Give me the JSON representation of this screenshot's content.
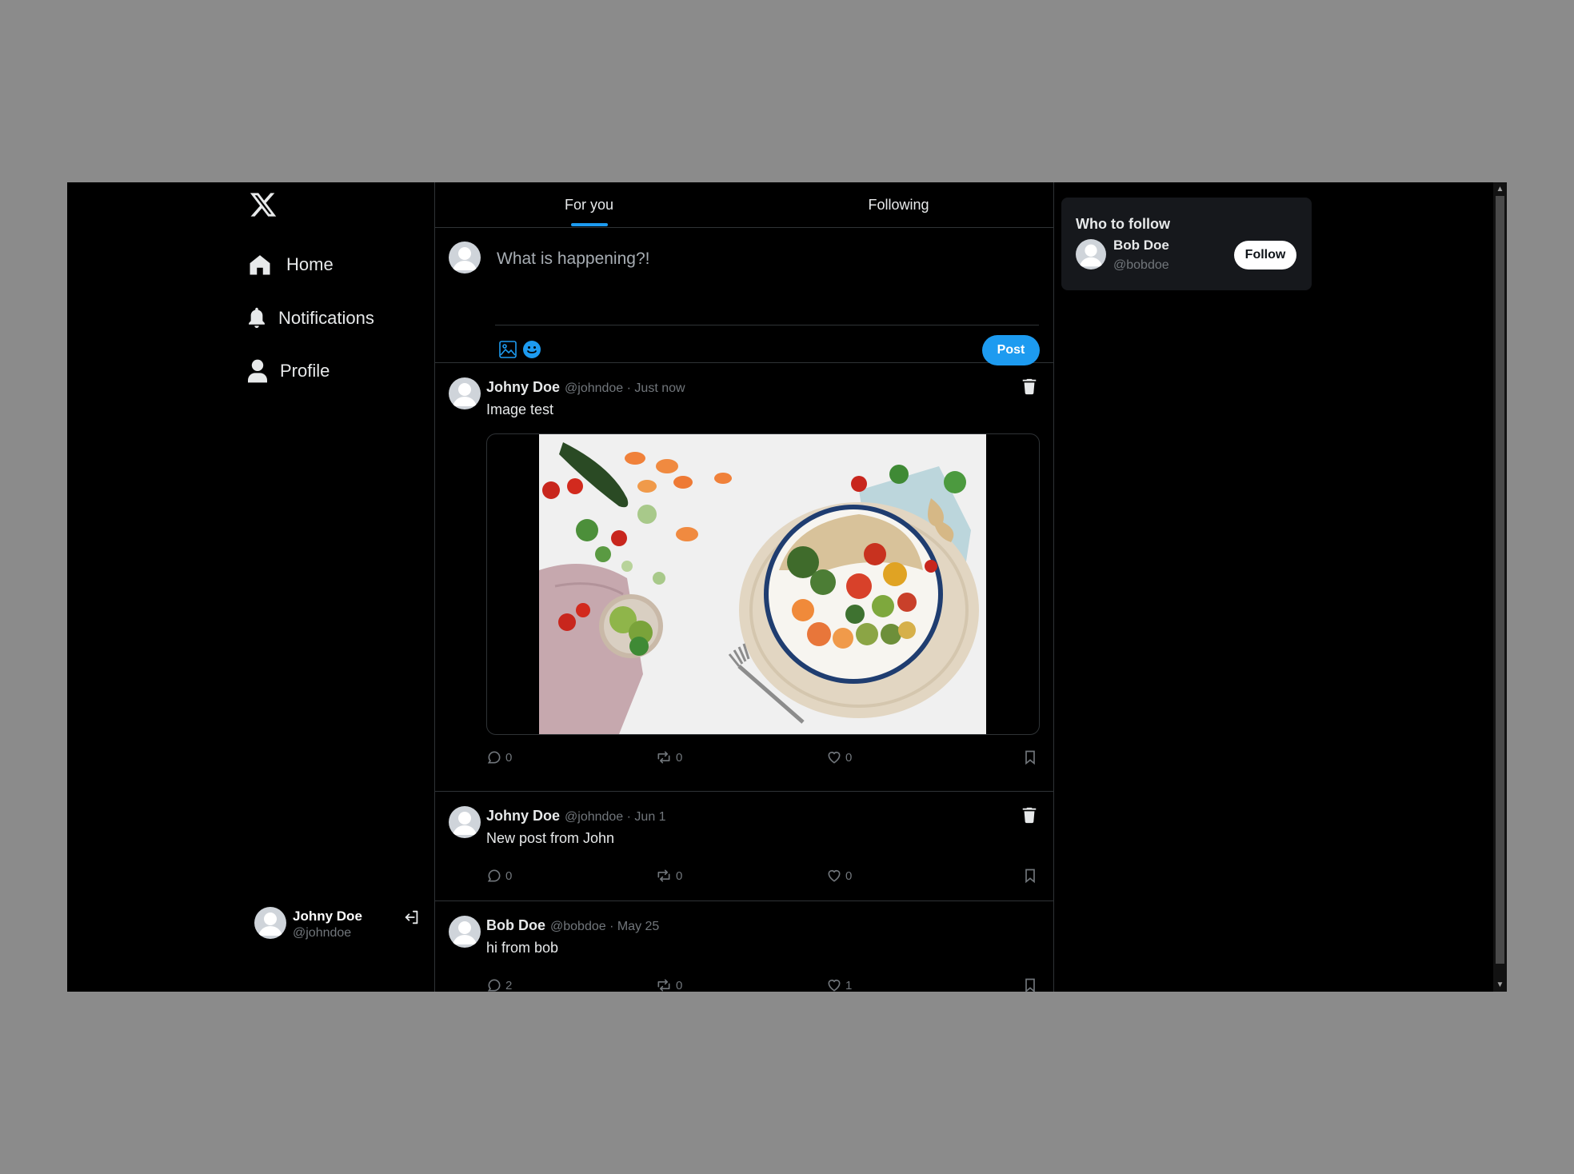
{
  "nav": {
    "logo": "x-logo",
    "items": [
      {
        "label": "Home",
        "icon": "home-icon"
      },
      {
        "label": "Notifications",
        "icon": "bell-icon"
      },
      {
        "label": "Profile",
        "icon": "user-icon"
      }
    ]
  },
  "account": {
    "name": "Johny Doe",
    "handle": "@johndoe"
  },
  "tabs": [
    {
      "label": "For you",
      "active": true
    },
    {
      "label": "Following",
      "active": false
    }
  ],
  "composer": {
    "placeholder": "What is happening?!",
    "post_label": "Post"
  },
  "posts": [
    {
      "name": "Johny Doe",
      "handle": "@johndoe",
      "time": "Just now",
      "meta": "@johndoe · Just now",
      "text": "Image test",
      "has_image": true,
      "deletable": true,
      "replies": "0",
      "reposts": "0",
      "likes": "0"
    },
    {
      "name": "Johny Doe",
      "handle": "@johndoe",
      "time": "Jun 1",
      "meta": "@johndoe · Jun 1",
      "text": "New post from John",
      "has_image": false,
      "deletable": true,
      "replies": "0",
      "reposts": "0",
      "likes": "0"
    },
    {
      "name": "Bob Doe",
      "handle": "@bobdoe",
      "time": "May 25",
      "meta": "@bobdoe · May 25",
      "text": "hi from bob",
      "has_image": false,
      "deletable": false,
      "replies": "2",
      "reposts": "0",
      "likes": "1"
    }
  ],
  "who_to_follow": {
    "title": "Who to follow",
    "users": [
      {
        "name": "Bob Doe",
        "handle": "@bobdoe",
        "button_label": "Follow"
      }
    ]
  },
  "colors": {
    "accent": "#1d9bf0",
    "background": "#000000",
    "border": "#2f3336",
    "muted_text": "#71767b",
    "card": "#16181c"
  }
}
